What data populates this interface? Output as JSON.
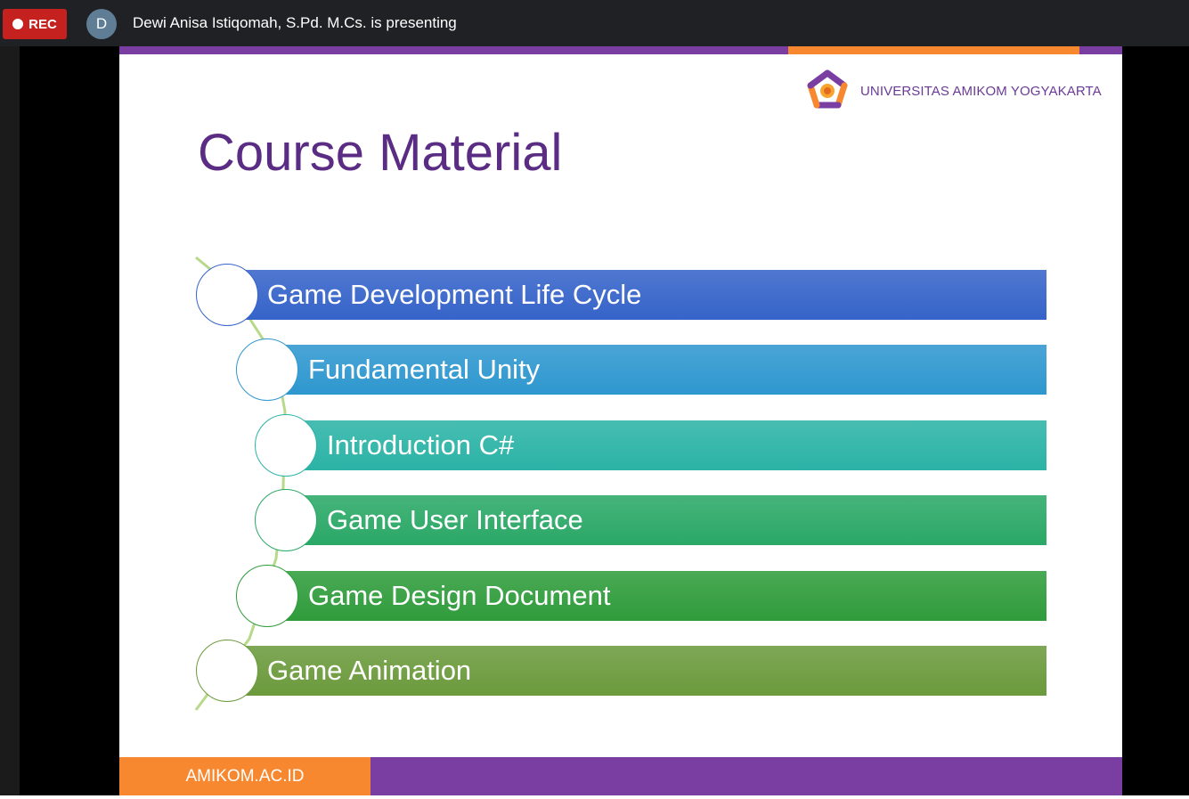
{
  "meeting": {
    "rec_label": "REC",
    "presenter_initial": "D",
    "presenter_text": "Dewi Anisa Istiqomah, S.Pd. M.Cs. is presenting"
  },
  "slide": {
    "university_name": "UNIVERSITAS AMIKOM YOGYAKARTA",
    "title": "Course Material",
    "footer_text": "AMIKOM.AC.ID",
    "items": [
      {
        "label": "Game Development Life Cycle",
        "color": "#3563c9"
      },
      {
        "label": "Fundamental Unity",
        "color": "#2e97cf"
      },
      {
        "label": "Introduction C#",
        "color": "#2bb3a6"
      },
      {
        "label": "Game User Interface",
        "color": "#2aa866"
      },
      {
        "label": "Game Design Document",
        "color": "#2f9c3b"
      },
      {
        "label": "Game Animation",
        "color": "#6b9a3c"
      }
    ]
  },
  "colors": {
    "purple": "#7a3ea2",
    "orange": "#f7882f",
    "rec_red": "#c5221f",
    "title_purple": "#5b2c83"
  },
  "icons": [
    "record-dot-icon",
    "amikom-logo-icon"
  ]
}
